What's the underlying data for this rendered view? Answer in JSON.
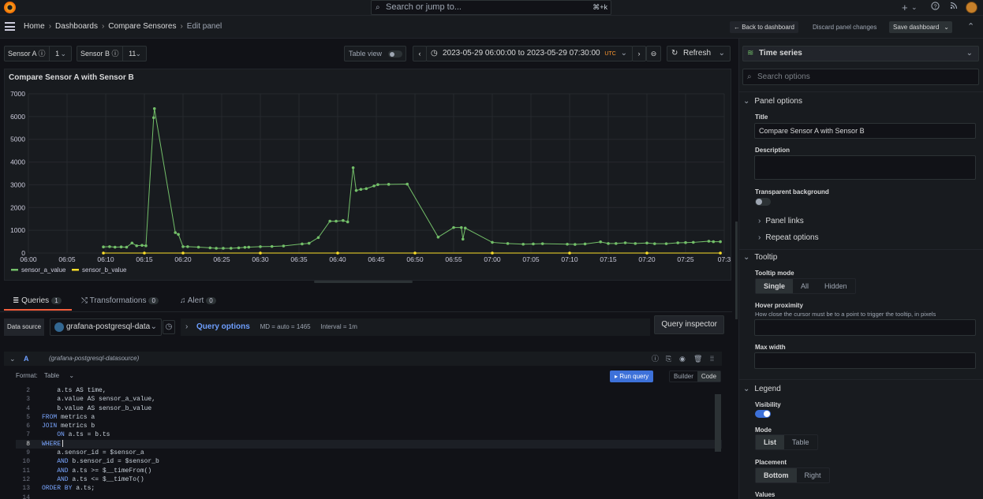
{
  "topbar": {
    "search_placeholder": "Search or jump to...",
    "search_shortcut": "⌘+k",
    "plus_icon": "+",
    "chevron": "⌄"
  },
  "nav": {
    "crumbs": [
      "Home",
      "Dashboards",
      "Compare Sensores",
      "Edit panel"
    ],
    "back_label": "← Back to dashboard",
    "discard_label": "Discard panel changes",
    "save_label": "Save dashboard"
  },
  "vars": {
    "a_label": "Sensor A",
    "a_value": "1",
    "b_label": "Sensor B",
    "b_value": "11"
  },
  "toolbar": {
    "table_view_label": "Table view",
    "time_range": "2023-05-29 06:00:00 to 2023-05-29 07:30:00",
    "timezone": "UTC",
    "refresh_label": "Refresh"
  },
  "panel": {
    "title": "Compare Sensor A with Sensor B"
  },
  "chart_data": {
    "type": "line",
    "title": "Compare Sensor A with Sensor B",
    "ylim": [
      0,
      7000
    ],
    "yticks": [
      "0",
      "1000",
      "2000",
      "3000",
      "4000",
      "5000",
      "6000",
      "7000"
    ],
    "xticks": [
      "06:00",
      "06:05",
      "06:10",
      "06:15",
      "06:20",
      "06:25",
      "06:30",
      "06:35",
      "06:40",
      "06:45",
      "06:50",
      "06:55",
      "07:00",
      "07:05",
      "07:10",
      "07:15",
      "07:20",
      "07:25",
      "07:3"
    ],
    "grid": true,
    "legend_position": "bottom-left",
    "series": [
      {
        "name": "sensor_a_value",
        "color": "#73bf69",
        "points": [
          [
            "06:09.7",
            270
          ],
          [
            "06:10.5",
            280
          ],
          [
            "06:11.2",
            260
          ],
          [
            "06:12",
            270
          ],
          [
            "06:12.7",
            260
          ],
          [
            "06:13.4",
            440
          ],
          [
            "06:14",
            320
          ],
          [
            "06:14.7",
            340
          ],
          [
            "06:15.2",
            320
          ],
          [
            "06:16.2",
            5950
          ],
          [
            "06:16.3",
            6350
          ],
          [
            "06:19.0",
            900
          ],
          [
            "06:19.4",
            820
          ],
          [
            "06:20",
            280
          ],
          [
            "06:20.6",
            280
          ],
          [
            "06:22",
            260
          ],
          [
            "06:23.5",
            230
          ],
          [
            "06:24.3",
            210
          ],
          [
            "06:25.2",
            210
          ],
          [
            "06:26.2",
            210
          ],
          [
            "06:27.2",
            230
          ],
          [
            "06:28",
            250
          ],
          [
            "06:28.5",
            260
          ],
          [
            "06:30",
            280
          ],
          [
            "06:31.5",
            290
          ],
          [
            "06:33",
            310
          ],
          [
            "06:35.4",
            400
          ],
          [
            "06:36.3",
            430
          ],
          [
            "06:37.5",
            680
          ],
          [
            "06:39",
            1400
          ],
          [
            "06:39.8",
            1400
          ],
          [
            "06:40.7",
            1430
          ],
          [
            "06:41.3",
            1370
          ],
          [
            "06:42",
            3750
          ],
          [
            "06:42.4",
            2750
          ],
          [
            "06:43",
            2800
          ],
          [
            "06:43.7",
            2830
          ],
          [
            "06:44.7",
            2950
          ],
          [
            "06:45.2",
            3010
          ],
          [
            "06:46.6",
            3020
          ],
          [
            "06:49",
            3030
          ],
          [
            "06:53",
            700
          ],
          [
            "06:55",
            1120
          ],
          [
            "06:56",
            1120
          ],
          [
            "06:56.2",
            610
          ],
          [
            "06:56.5",
            1100
          ],
          [
            "07:00",
            470
          ],
          [
            "07:02",
            420
          ],
          [
            "07:04",
            390
          ],
          [
            "07:05.3",
            400
          ],
          [
            "07:06.5",
            410
          ],
          [
            "07:09.7",
            390
          ],
          [
            "07:10.7",
            380
          ],
          [
            "07:12",
            400
          ],
          [
            "07:14",
            490
          ],
          [
            "07:15",
            420
          ],
          [
            "07:16",
            420
          ],
          [
            "07:17.2",
            450
          ],
          [
            "07:18.5",
            420
          ],
          [
            "07:20",
            440
          ],
          [
            "07:21",
            410
          ],
          [
            "07:22.5",
            410
          ],
          [
            "07:24",
            450
          ],
          [
            "07:25",
            460
          ],
          [
            "07:26",
            470
          ],
          [
            "07:28",
            520
          ],
          [
            "07:28.6",
            500
          ],
          [
            "07:29.5",
            500
          ]
        ]
      },
      {
        "name": "sensor_b_value",
        "color": "#fade2a",
        "points": [
          [
            "06:09.7",
            0
          ],
          [
            "06:15",
            0
          ],
          [
            "06:20",
            0
          ],
          [
            "06:30",
            0
          ],
          [
            "06:40",
            0
          ],
          [
            "06:50",
            0
          ],
          [
            "07:00",
            0
          ],
          [
            "07:10",
            0
          ],
          [
            "07:20",
            0
          ],
          [
            "07:29.5",
            0
          ]
        ]
      }
    ]
  },
  "query_tabs": [
    {
      "label": "Queries",
      "count": "1"
    },
    {
      "label": "Transformations",
      "count": "0"
    },
    {
      "label": "Alert",
      "count": "0"
    }
  ],
  "datasource": {
    "label": "Data source",
    "value": "grafana-postgresql-data",
    "query_options_label": "Query options",
    "md": "MD = auto = 1465",
    "interval": "Interval = 1m",
    "inspector_label": "Query inspector"
  },
  "query": {
    "ref": "A",
    "ds_name": "(grafana-postgresql-datasource)",
    "format_label": "Format:",
    "format_value": "Table",
    "run_label": "Run query",
    "builder_label": "Builder",
    "code_label": "Code",
    "lines": [
      {
        "n": "2",
        "pre": "    ",
        "kw": "",
        "text": "a.ts AS time,"
      },
      {
        "n": "3",
        "pre": "    ",
        "kw": "",
        "text": "a.value AS sensor_a_value,"
      },
      {
        "n": "4",
        "pre": "    ",
        "kw": "",
        "text": "b.value AS sensor_b_value"
      },
      {
        "n": "5",
        "pre": "",
        "kw": "FROM",
        "text": " metrics a"
      },
      {
        "n": "6",
        "pre": "",
        "kw": "JOIN",
        "text": " metrics b"
      },
      {
        "n": "7",
        "pre": "    ",
        "kw": "ON",
        "text": " a.ts = b.ts"
      },
      {
        "n": "8",
        "pre": "",
        "kw": "WHERE",
        "text": ""
      },
      {
        "n": "9",
        "pre": "    ",
        "kw": "",
        "text": "a.sensor_id = $sensor_a"
      },
      {
        "n": "10",
        "pre": "    ",
        "kw": "AND",
        "text": " b.sensor_id = $sensor_b"
      },
      {
        "n": "11",
        "pre": "    ",
        "kw": "AND",
        "text": " a.ts >= $__timeFrom()"
      },
      {
        "n": "12",
        "pre": "    ",
        "kw": "AND",
        "text": " a.ts <= $__timeTo()"
      },
      {
        "n": "13",
        "pre": "",
        "kw": "ORDER BY",
        "text": " a.ts;"
      },
      {
        "n": "14",
        "pre": "",
        "kw": "",
        "text": ""
      }
    ]
  },
  "options": {
    "viz_label": "Time series",
    "search_placeholder": "Search options",
    "panel_options": "Panel options",
    "title_label": "Title",
    "title_value": "Compare Sensor A with Sensor B",
    "description_label": "Description",
    "transparent_label": "Transparent background",
    "panel_links": "Panel links",
    "repeat_options": "Repeat options",
    "tooltip": "Tooltip",
    "tooltip_mode_label": "Tooltip mode",
    "tooltip_modes": [
      "Single",
      "All",
      "Hidden"
    ],
    "hover_label": "Hover proximity",
    "hover_desc": "How close the cursor must be to a point to trigger the tooltip, in pixels",
    "max_width_label": "Max width",
    "legend": "Legend",
    "visibility_label": "Visibility",
    "mode_label": "Mode",
    "modes": [
      "List",
      "Table"
    ],
    "placement_label": "Placement",
    "placements": [
      "Bottom",
      "Right"
    ],
    "values_label": "Values"
  }
}
